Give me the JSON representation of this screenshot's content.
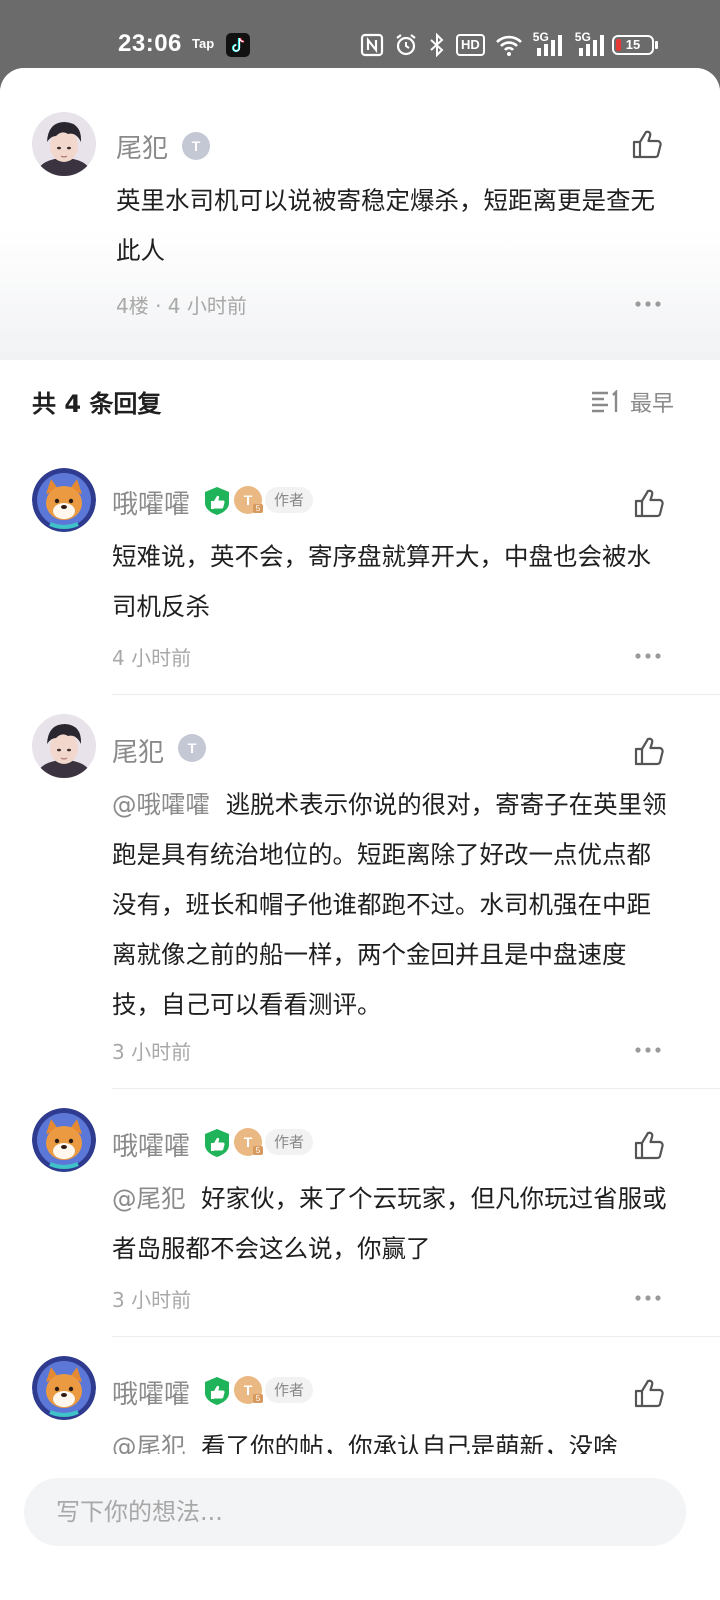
{
  "status_bar": {
    "time": "23:06",
    "tap_label": "Tap",
    "network_label": "5G",
    "network_label_2": "5G",
    "hd_label": "HD",
    "battery_level": "15",
    "battery_fraction": 0.15
  },
  "parent_comment": {
    "author": "尾犯",
    "badge": "T",
    "content": "英里水司机可以说被寄稳定爆杀，短距离更是查无此人",
    "meta": "4楼 · 4 小时前"
  },
  "replies_header": {
    "title": "共 4 条回复",
    "sort_label": "最早"
  },
  "replies": [
    {
      "author": "哦嚯嚯",
      "badge": "T",
      "badge_level": "5",
      "author_tag": "作者",
      "mention": "",
      "content": "短难说，英不会，寄序盘就算开大，中盘也会被水司机反杀",
      "time": "4 小时前"
    },
    {
      "author": "尾犯",
      "badge": "T",
      "mention": "@哦嚯嚯",
      "content": "逃脱术表示你说的很对，寄寄子在英里领跑是具有统治地位的。短距离除了好改一点优点都没有，班长和帽子他谁都跑不过。水司机强在中距离就像之前的船一样，两个金回并且是中盘速度技，自己可以看看测评。",
      "time": "3 小时前"
    },
    {
      "author": "哦嚯嚯",
      "badge": "T",
      "badge_level": "5",
      "author_tag": "作者",
      "mention": "@尾犯",
      "content": "好家伙，来了个云玩家，但凡你玩过省服或者岛服都不会这么说，你赢了",
      "time": "3 小时前"
    },
    {
      "author": "哦嚯嚯",
      "badge": "T",
      "badge_level": "5",
      "author_tag": "作者",
      "mention": "@尾犯",
      "content": "看了你的帖，你承认自己是萌新，没啥",
      "time": ""
    }
  ],
  "input": {
    "placeholder": "写下你的想法..."
  },
  "colors": {
    "accent_green": "#1fb45a",
    "badge_silver": "#b9bfcc",
    "badge_gold": "#e8b07a",
    "battery_red": "#e53935"
  },
  "icons": [
    "nfc-icon",
    "alarm-icon",
    "bluetooth-icon",
    "wifi-icon",
    "signal-icon",
    "battery-icon",
    "like-icon",
    "more-icon",
    "sort-icon",
    "tiktok-icon"
  ]
}
